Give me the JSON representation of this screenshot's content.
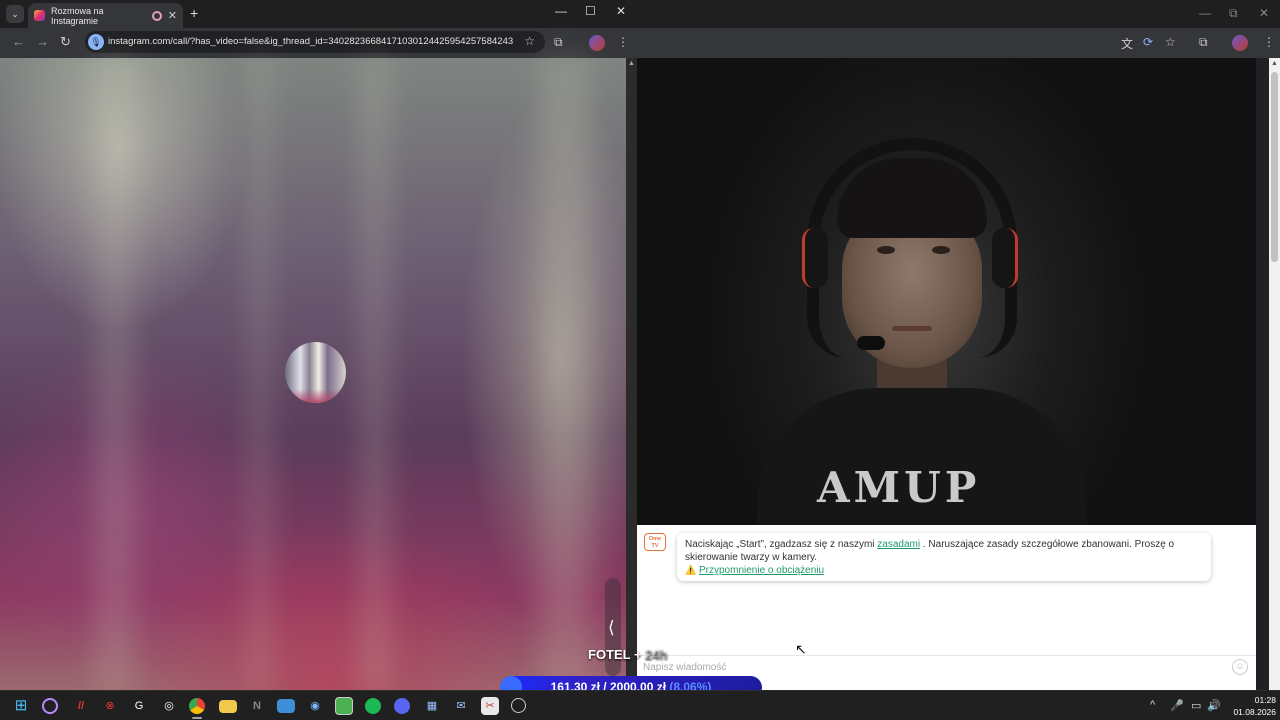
{
  "left_window": {
    "tab_title": "Rozmowa na Instagramie",
    "url": "instagram.com/call/?has_video=false&ig_thread_id=340282366841710301244259542575842434...",
    "new_tab": "+",
    "minimize": "—",
    "maximize": "☐",
    "close": "✕"
  },
  "right_window": {
    "chat": {
      "message_prefix": "Naciskając „Start”, zgadzasz się z naszymi ",
      "rules_link": "zasadami",
      "message_suffix": " . Naruszające zasady szczegółowe zbanowani. Proszę o skierowanie twarzy w kamery.",
      "warning_link": "Przypomnienie o obciążeniu",
      "input_placeholder": "Napisz wiadomość",
      "logo_text": "Ome TV"
    },
    "shirt_print": "AMUP"
  },
  "overlay": {
    "fotel_label": "FOTEL + ",
    "fotel_dim": "24h",
    "goal_current": "161,30 zł",
    "goal_sep": " / ",
    "goal_target": "2000,00 zł",
    "goal_percent": "(8.06%)",
    "goal_fraction": 0.0806
  },
  "taskbar": {
    "time": "01:28",
    "date": "01.08.2026"
  }
}
